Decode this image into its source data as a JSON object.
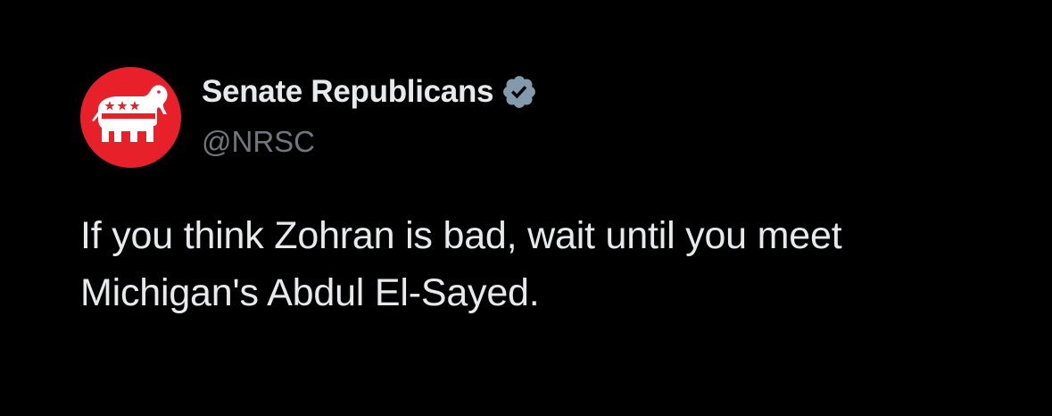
{
  "author": {
    "display_name": "Senate Republicans",
    "handle": "@NRSC",
    "verified": true,
    "verified_badge_icon": "verified-badge-icon",
    "avatar_icon": "gop-elephant-logo",
    "avatar_color": "#e8202a"
  },
  "tweet": {
    "text_lines": [
      "If you think Zohran is bad, wait until you meet",
      "Michigan's Abdul El-Sayed."
    ]
  },
  "colors": {
    "background": "#000000",
    "primary_text": "#e7e9ea",
    "secondary_text": "#71767b",
    "verified_badge": "#829aab"
  }
}
